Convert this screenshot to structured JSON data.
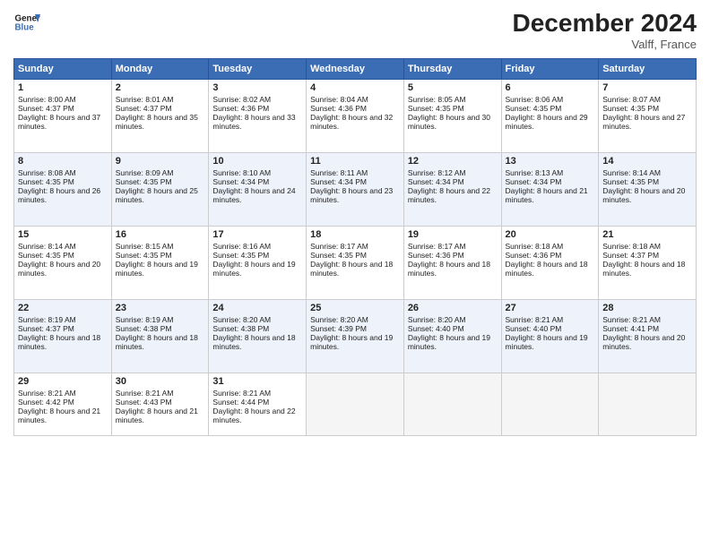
{
  "header": {
    "logo_line1": "General",
    "logo_line2": "Blue",
    "month": "December 2024",
    "location": "Valff, France"
  },
  "days_of_week": [
    "Sunday",
    "Monday",
    "Tuesday",
    "Wednesday",
    "Thursday",
    "Friday",
    "Saturday"
  ],
  "weeks": [
    [
      {
        "day": "1",
        "rise": "8:00 AM",
        "set": "4:37 PM",
        "daylight": "8 hours and 37 minutes."
      },
      {
        "day": "2",
        "rise": "8:01 AM",
        "set": "4:37 PM",
        "daylight": "8 hours and 35 minutes."
      },
      {
        "day": "3",
        "rise": "8:02 AM",
        "set": "4:36 PM",
        "daylight": "8 hours and 33 minutes."
      },
      {
        "day": "4",
        "rise": "8:04 AM",
        "set": "4:36 PM",
        "daylight": "8 hours and 32 minutes."
      },
      {
        "day": "5",
        "rise": "8:05 AM",
        "set": "4:35 PM",
        "daylight": "8 hours and 30 minutes."
      },
      {
        "day": "6",
        "rise": "8:06 AM",
        "set": "4:35 PM",
        "daylight": "8 hours and 29 minutes."
      },
      {
        "day": "7",
        "rise": "8:07 AM",
        "set": "4:35 PM",
        "daylight": "8 hours and 27 minutes."
      }
    ],
    [
      {
        "day": "8",
        "rise": "8:08 AM",
        "set": "4:35 PM",
        "daylight": "8 hours and 26 minutes."
      },
      {
        "day": "9",
        "rise": "8:09 AM",
        "set": "4:35 PM",
        "daylight": "8 hours and 25 minutes."
      },
      {
        "day": "10",
        "rise": "8:10 AM",
        "set": "4:34 PM",
        "daylight": "8 hours and 24 minutes."
      },
      {
        "day": "11",
        "rise": "8:11 AM",
        "set": "4:34 PM",
        "daylight": "8 hours and 23 minutes."
      },
      {
        "day": "12",
        "rise": "8:12 AM",
        "set": "4:34 PM",
        "daylight": "8 hours and 22 minutes."
      },
      {
        "day": "13",
        "rise": "8:13 AM",
        "set": "4:34 PM",
        "daylight": "8 hours and 21 minutes."
      },
      {
        "day": "14",
        "rise": "8:14 AM",
        "set": "4:35 PM",
        "daylight": "8 hours and 20 minutes."
      }
    ],
    [
      {
        "day": "15",
        "rise": "8:14 AM",
        "set": "4:35 PM",
        "daylight": "8 hours and 20 minutes."
      },
      {
        "day": "16",
        "rise": "8:15 AM",
        "set": "4:35 PM",
        "daylight": "8 hours and 19 minutes."
      },
      {
        "day": "17",
        "rise": "8:16 AM",
        "set": "4:35 PM",
        "daylight": "8 hours and 19 minutes."
      },
      {
        "day": "18",
        "rise": "8:17 AM",
        "set": "4:35 PM",
        "daylight": "8 hours and 18 minutes."
      },
      {
        "day": "19",
        "rise": "8:17 AM",
        "set": "4:36 PM",
        "daylight": "8 hours and 18 minutes."
      },
      {
        "day": "20",
        "rise": "8:18 AM",
        "set": "4:36 PM",
        "daylight": "8 hours and 18 minutes."
      },
      {
        "day": "21",
        "rise": "8:18 AM",
        "set": "4:37 PM",
        "daylight": "8 hours and 18 minutes."
      }
    ],
    [
      {
        "day": "22",
        "rise": "8:19 AM",
        "set": "4:37 PM",
        "daylight": "8 hours and 18 minutes."
      },
      {
        "day": "23",
        "rise": "8:19 AM",
        "set": "4:38 PM",
        "daylight": "8 hours and 18 minutes."
      },
      {
        "day": "24",
        "rise": "8:20 AM",
        "set": "4:38 PM",
        "daylight": "8 hours and 18 minutes."
      },
      {
        "day": "25",
        "rise": "8:20 AM",
        "set": "4:39 PM",
        "daylight": "8 hours and 19 minutes."
      },
      {
        "day": "26",
        "rise": "8:20 AM",
        "set": "4:40 PM",
        "daylight": "8 hours and 19 minutes."
      },
      {
        "day": "27",
        "rise": "8:21 AM",
        "set": "4:40 PM",
        "daylight": "8 hours and 19 minutes."
      },
      {
        "day": "28",
        "rise": "8:21 AM",
        "set": "4:41 PM",
        "daylight": "8 hours and 20 minutes."
      }
    ],
    [
      {
        "day": "29",
        "rise": "8:21 AM",
        "set": "4:42 PM",
        "daylight": "8 hours and 21 minutes."
      },
      {
        "day": "30",
        "rise": "8:21 AM",
        "set": "4:43 PM",
        "daylight": "8 hours and 21 minutes."
      },
      {
        "day": "31",
        "rise": "8:21 AM",
        "set": "4:44 PM",
        "daylight": "8 hours and 22 minutes."
      },
      null,
      null,
      null,
      null
    ]
  ],
  "labels": {
    "sunrise": "Sunrise:",
    "sunset": "Sunset:",
    "daylight": "Daylight:"
  }
}
